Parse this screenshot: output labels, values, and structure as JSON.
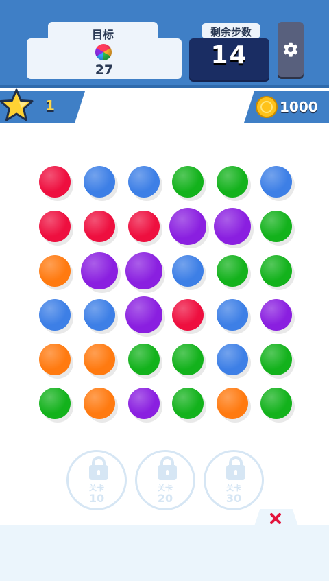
{
  "header": {
    "goal_label": "目标",
    "goal_count": "27",
    "moves_label": "剩余步数",
    "moves_value": "14",
    "settings_icon": "gear-icon"
  },
  "stats": {
    "stars_icon": "star-icon",
    "stars_value": "1",
    "coins_icon": "coin-icon",
    "coins_value": "1000"
  },
  "colors": {
    "red": "#ee0f3f",
    "blue": "#3d7fe6",
    "green": "#13b21c",
    "purple": "#8a1fe0",
    "orange": "#ff7a10",
    "header_blue": "#3f7fc6",
    "moves_box": "#1a2d63"
  },
  "board": {
    "rows": [
      [
        "red",
        "blue",
        "blue",
        "green",
        "green",
        "blue"
      ],
      [
        "red",
        "red",
        "red",
        "purple",
        "purple",
        "green"
      ],
      [
        "orange",
        "purple",
        "purple",
        "blue",
        "green",
        "green"
      ],
      [
        "blue",
        "blue",
        "purple",
        "red",
        "blue",
        "purple"
      ],
      [
        "orange",
        "orange",
        "green",
        "green",
        "blue",
        "green"
      ],
      [
        "green",
        "orange",
        "purple",
        "green",
        "orange",
        "green"
      ]
    ],
    "large_cells": [
      [
        1,
        3
      ],
      [
        1,
        4
      ],
      [
        2,
        1
      ],
      [
        2,
        2
      ],
      [
        3,
        2
      ]
    ]
  },
  "locked_levels": [
    {
      "label": "关卡",
      "level": "10",
      "icon": "lock-icon"
    },
    {
      "label": "关卡",
      "level": "20",
      "icon": "lock-icon"
    },
    {
      "label": "关卡",
      "level": "30",
      "icon": "lock-icon"
    }
  ],
  "footer": {
    "close_icon": "close-icon"
  }
}
